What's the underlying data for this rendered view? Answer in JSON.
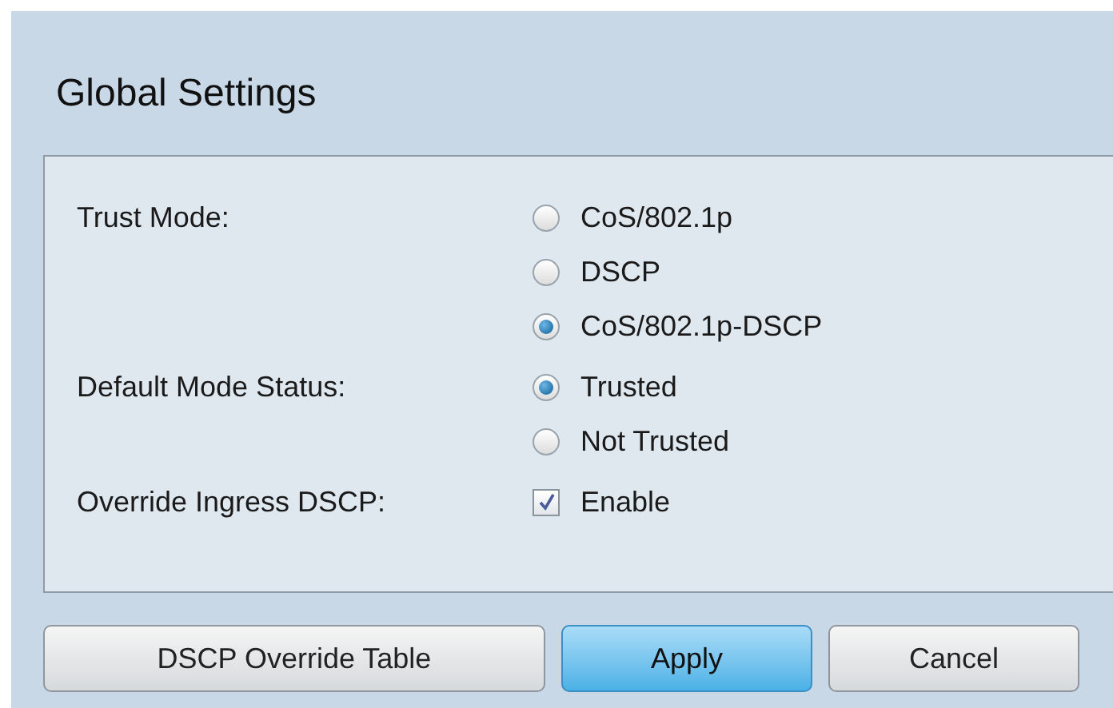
{
  "title": "Global Settings",
  "fields": [
    {
      "label": "Trust Mode:",
      "kind": "radio",
      "options": [
        {
          "label": "CoS/802.1p",
          "selected": false
        },
        {
          "label": "DSCP",
          "selected": false
        },
        {
          "label": "CoS/802.1p-DSCP",
          "selected": true
        }
      ]
    },
    {
      "label": "Default Mode Status:",
      "kind": "radio",
      "options": [
        {
          "label": "Trusted",
          "selected": true
        },
        {
          "label": "Not Trusted",
          "selected": false
        }
      ]
    },
    {
      "label": "Override Ingress DSCP:",
      "kind": "checkbox",
      "option": {
        "label": "Enable",
        "checked": true
      }
    }
  ],
  "buttons": [
    {
      "label": "DSCP Override Table",
      "primary": false
    },
    {
      "label": "Apply",
      "primary": true
    },
    {
      "label": "Cancel",
      "primary": false
    }
  ]
}
